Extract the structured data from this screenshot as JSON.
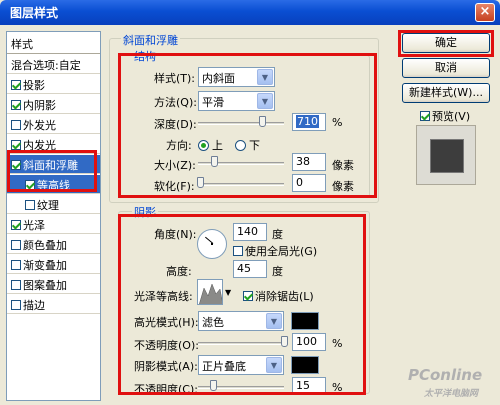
{
  "window": {
    "title": "图层样式",
    "close_label": "×"
  },
  "stylelist": {
    "header": "样式",
    "items": [
      {
        "label": "混合选项:自定",
        "checkbox": false,
        "checked": false
      },
      {
        "label": "投影",
        "checkbox": true,
        "checked": true
      },
      {
        "label": "内阴影",
        "checkbox": true,
        "checked": true
      },
      {
        "label": "外发光",
        "checkbox": true,
        "checked": false
      },
      {
        "label": "内发光",
        "checkbox": true,
        "checked": true
      },
      {
        "label": "斜面和浮雕",
        "checkbox": true,
        "checked": true,
        "selected": true
      },
      {
        "label": "等高线",
        "checkbox": true,
        "checked": true,
        "selected": true,
        "sub": true
      },
      {
        "label": "纹理",
        "checkbox": true,
        "checked": false,
        "sub": true
      },
      {
        "label": "光泽",
        "checkbox": true,
        "checked": true
      },
      {
        "label": "颜色叠加",
        "checkbox": true,
        "checked": false
      },
      {
        "label": "渐变叠加",
        "checkbox": true,
        "checked": false
      },
      {
        "label": "图案叠加",
        "checkbox": true,
        "checked": false
      },
      {
        "label": "描边",
        "checkbox": true,
        "checked": false
      }
    ]
  },
  "bevel": {
    "group_title": "斜面和浮雕",
    "structure_title": "结构",
    "style_label": "样式(T):",
    "style_value": "内斜面",
    "technique_label": "方法(Q):",
    "technique_value": "平滑",
    "depth_label": "深度(D):",
    "depth_value": "710",
    "depth_unit": "%",
    "direction_label": "方向:",
    "direction_up": "上",
    "direction_down": "下",
    "size_label": "大小(Z):",
    "size_value": "38",
    "size_unit": "像素",
    "soften_label": "软化(F):",
    "soften_value": "0",
    "soften_unit": "像素"
  },
  "shading": {
    "group_title": "阴影",
    "angle_label": "角度(N):",
    "angle_value": "140",
    "angle_unit": "度",
    "global_light_label": "使用全局光(G)",
    "altitude_label": "高度:",
    "altitude_value": "45",
    "altitude_unit": "度",
    "gloss_contour_label": "光泽等高线:",
    "anti_alias_label": "消除锯齿(L)",
    "highlight_mode_label": "高光模式(H):",
    "highlight_mode_value": "滤色",
    "highlight_opacity_label": "不透明度(O):",
    "highlight_opacity_value": "100",
    "highlight_opacity_unit": "%",
    "shadow_mode_label": "阴影模式(A):",
    "shadow_mode_value": "正片叠底",
    "shadow_opacity_label": "不透明度(C):",
    "shadow_opacity_value": "15",
    "shadow_opacity_unit": "%"
  },
  "buttons": {
    "ok": "确定",
    "cancel": "取消",
    "new_style": "新建样式(W)...",
    "preview_label": "预览(V)"
  },
  "watermark": {
    "brand": "PConline",
    "sub": "太平洋电脑网"
  },
  "colors": {
    "highlight": "#000000",
    "shadow": "#000000",
    "accent": "#316ac5",
    "annotation": "#e01010"
  },
  "slider_levels": {
    "depth": 0.71,
    "size": 0.15,
    "soften": 0.0,
    "highlight_opacity": 1.0,
    "shadow_opacity": 0.15
  }
}
